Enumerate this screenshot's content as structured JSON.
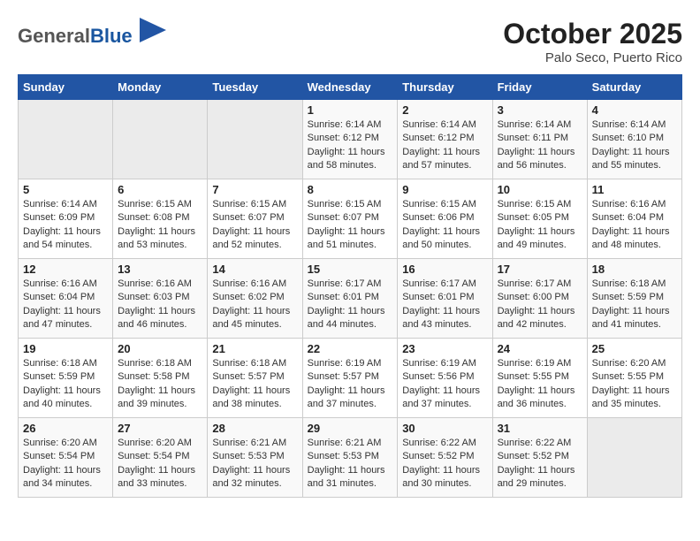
{
  "header": {
    "logo_general": "General",
    "logo_blue": "Blue",
    "month": "October 2025",
    "location": "Palo Seco, Puerto Rico"
  },
  "weekdays": [
    "Sunday",
    "Monday",
    "Tuesday",
    "Wednesday",
    "Thursday",
    "Friday",
    "Saturday"
  ],
  "weeks": [
    [
      {
        "day": "",
        "info": ""
      },
      {
        "day": "",
        "info": ""
      },
      {
        "day": "",
        "info": ""
      },
      {
        "day": "1",
        "info": "Sunrise: 6:14 AM\nSunset: 6:12 PM\nDaylight: 11 hours\nand 58 minutes."
      },
      {
        "day": "2",
        "info": "Sunrise: 6:14 AM\nSunset: 6:12 PM\nDaylight: 11 hours\nand 57 minutes."
      },
      {
        "day": "3",
        "info": "Sunrise: 6:14 AM\nSunset: 6:11 PM\nDaylight: 11 hours\nand 56 minutes."
      },
      {
        "day": "4",
        "info": "Sunrise: 6:14 AM\nSunset: 6:10 PM\nDaylight: 11 hours\nand 55 minutes."
      }
    ],
    [
      {
        "day": "5",
        "info": "Sunrise: 6:14 AM\nSunset: 6:09 PM\nDaylight: 11 hours\nand 54 minutes."
      },
      {
        "day": "6",
        "info": "Sunrise: 6:15 AM\nSunset: 6:08 PM\nDaylight: 11 hours\nand 53 minutes."
      },
      {
        "day": "7",
        "info": "Sunrise: 6:15 AM\nSunset: 6:07 PM\nDaylight: 11 hours\nand 52 minutes."
      },
      {
        "day": "8",
        "info": "Sunrise: 6:15 AM\nSunset: 6:07 PM\nDaylight: 11 hours\nand 51 minutes."
      },
      {
        "day": "9",
        "info": "Sunrise: 6:15 AM\nSunset: 6:06 PM\nDaylight: 11 hours\nand 50 minutes."
      },
      {
        "day": "10",
        "info": "Sunrise: 6:15 AM\nSunset: 6:05 PM\nDaylight: 11 hours\nand 49 minutes."
      },
      {
        "day": "11",
        "info": "Sunrise: 6:16 AM\nSunset: 6:04 PM\nDaylight: 11 hours\nand 48 minutes."
      }
    ],
    [
      {
        "day": "12",
        "info": "Sunrise: 6:16 AM\nSunset: 6:04 PM\nDaylight: 11 hours\nand 47 minutes."
      },
      {
        "day": "13",
        "info": "Sunrise: 6:16 AM\nSunset: 6:03 PM\nDaylight: 11 hours\nand 46 minutes."
      },
      {
        "day": "14",
        "info": "Sunrise: 6:16 AM\nSunset: 6:02 PM\nDaylight: 11 hours\nand 45 minutes."
      },
      {
        "day": "15",
        "info": "Sunrise: 6:17 AM\nSunset: 6:01 PM\nDaylight: 11 hours\nand 44 minutes."
      },
      {
        "day": "16",
        "info": "Sunrise: 6:17 AM\nSunset: 6:01 PM\nDaylight: 11 hours\nand 43 minutes."
      },
      {
        "day": "17",
        "info": "Sunrise: 6:17 AM\nSunset: 6:00 PM\nDaylight: 11 hours\nand 42 minutes."
      },
      {
        "day": "18",
        "info": "Sunrise: 6:18 AM\nSunset: 5:59 PM\nDaylight: 11 hours\nand 41 minutes."
      }
    ],
    [
      {
        "day": "19",
        "info": "Sunrise: 6:18 AM\nSunset: 5:59 PM\nDaylight: 11 hours\nand 40 minutes."
      },
      {
        "day": "20",
        "info": "Sunrise: 6:18 AM\nSunset: 5:58 PM\nDaylight: 11 hours\nand 39 minutes."
      },
      {
        "day": "21",
        "info": "Sunrise: 6:18 AM\nSunset: 5:57 PM\nDaylight: 11 hours\nand 38 minutes."
      },
      {
        "day": "22",
        "info": "Sunrise: 6:19 AM\nSunset: 5:57 PM\nDaylight: 11 hours\nand 37 minutes."
      },
      {
        "day": "23",
        "info": "Sunrise: 6:19 AM\nSunset: 5:56 PM\nDaylight: 11 hours\nand 37 minutes."
      },
      {
        "day": "24",
        "info": "Sunrise: 6:19 AM\nSunset: 5:55 PM\nDaylight: 11 hours\nand 36 minutes."
      },
      {
        "day": "25",
        "info": "Sunrise: 6:20 AM\nSunset: 5:55 PM\nDaylight: 11 hours\nand 35 minutes."
      }
    ],
    [
      {
        "day": "26",
        "info": "Sunrise: 6:20 AM\nSunset: 5:54 PM\nDaylight: 11 hours\nand 34 minutes."
      },
      {
        "day": "27",
        "info": "Sunrise: 6:20 AM\nSunset: 5:54 PM\nDaylight: 11 hours\nand 33 minutes."
      },
      {
        "day": "28",
        "info": "Sunrise: 6:21 AM\nSunset: 5:53 PM\nDaylight: 11 hours\nand 32 minutes."
      },
      {
        "day": "29",
        "info": "Sunrise: 6:21 AM\nSunset: 5:53 PM\nDaylight: 11 hours\nand 31 minutes."
      },
      {
        "day": "30",
        "info": "Sunrise: 6:22 AM\nSunset: 5:52 PM\nDaylight: 11 hours\nand 30 minutes."
      },
      {
        "day": "31",
        "info": "Sunrise: 6:22 AM\nSunset: 5:52 PM\nDaylight: 11 hours\nand 29 minutes."
      },
      {
        "day": "",
        "info": ""
      }
    ]
  ]
}
